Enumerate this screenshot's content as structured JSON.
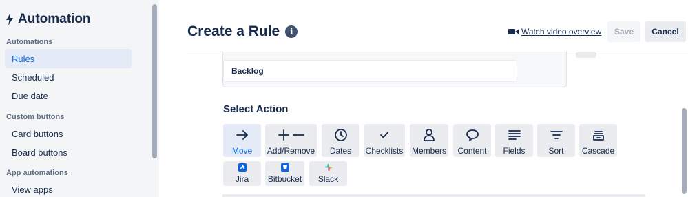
{
  "sidebar": {
    "title": "Automation",
    "sections": [
      {
        "heading": "Automations",
        "items": [
          "Rules",
          "Scheduled",
          "Due date"
        ]
      },
      {
        "heading": "Custom buttons",
        "items": [
          "Card buttons",
          "Board buttons"
        ]
      },
      {
        "heading": "App automations",
        "items": [
          "View apps"
        ]
      }
    ],
    "active_item": "Rules"
  },
  "header": {
    "title": "Create a Rule",
    "video_link": "Watch video overview",
    "save_label": "Save",
    "cancel_label": "Cancel"
  },
  "trigger_card": {
    "list_name": "Backlog"
  },
  "select_action": {
    "title": "Select Action",
    "actions": [
      "Move",
      "Add/Remove",
      "Dates",
      "Checklists",
      "Members",
      "Content",
      "Fields",
      "Sort",
      "Cascade"
    ],
    "integrations": [
      "Jira",
      "Bitbucket",
      "Slack"
    ],
    "active_action": "Move"
  },
  "colors": {
    "accent": "#0c66e4",
    "active_bg": "#e4ebf6",
    "tile_bg": "#ebecf0",
    "text": "#172b4d"
  }
}
